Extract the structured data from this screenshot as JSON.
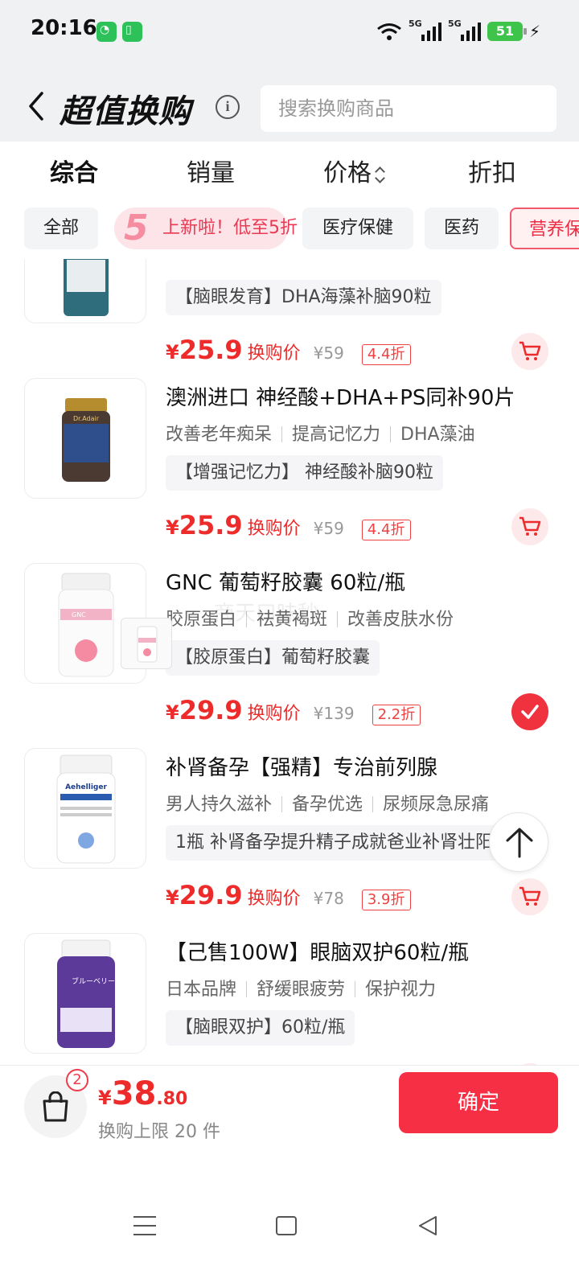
{
  "status_bar": {
    "time": "20:16",
    "net1": "5G",
    "net2": "5G",
    "battery": "51"
  },
  "header": {
    "title": "超值换购",
    "info": "i",
    "search_placeholder": "搜索换购商品"
  },
  "sort_tabs": [
    {
      "label": "综合",
      "active": true
    },
    {
      "label": "销量",
      "active": false
    },
    {
      "label": "价格",
      "active": false,
      "sortable": true
    },
    {
      "label": "折扣",
      "active": false
    }
  ],
  "chips": [
    {
      "label": "全部"
    },
    {
      "label": "上新啦！低至5折",
      "badge": "5"
    },
    {
      "label": "医疗保健"
    },
    {
      "label": "医药"
    },
    {
      "label": "营养保",
      "selected": true
    }
  ],
  "products": [
    {
      "promo": "【脑眼发育】DHA海藻补脑90粒",
      "price_yen": "¥",
      "price": "25.9",
      "price_label": "换购价",
      "orig_price": "¥59",
      "discount": "4.4折",
      "in_cart": false
    },
    {
      "title": "澳洲进口 神经酸+DHA+PS同补90片",
      "tags": [
        "改善老年痴呆",
        "提高记忆力",
        "DHA藻油"
      ],
      "promo": "【增强记忆力】 神经酸补脑90粒",
      "price_yen": "¥",
      "price": "25.9",
      "price_label": "换购价",
      "orig_price": "¥59",
      "discount": "4.4折",
      "in_cart": false,
      "brand": "Dr.Adair"
    },
    {
      "title": "GNC 葡萄籽胶囊 60粒/瓶",
      "tags": [
        "胶原蛋白",
        "祛黄褐斑",
        "改善皮肤水份"
      ],
      "promo": "【胶原蛋白】葡萄籽胶囊",
      "price_yen": "¥",
      "price": "29.9",
      "price_label": "换购价",
      "orig_price": "¥139",
      "discount": "2.2折",
      "in_cart": true,
      "brand": "GNC"
    },
    {
      "title": "补肾备孕【强精】专治前列腺",
      "tags": [
        "男人持久滋补",
        "备孕优选",
        "尿频尿急尿痛"
      ],
      "promo": "1瓶 补肾备孕提升精子成就爸业补肾壮阳强",
      "price_yen": "¥",
      "price": "29.9",
      "price_label": "换购价",
      "orig_price": "¥78",
      "discount": "3.9折",
      "in_cart": false,
      "brand": "Aehelliger"
    },
    {
      "title": "【己售100W】眼脑双护60粒/瓶",
      "tags": [
        "日本品牌",
        "舒缓眼疲劳",
        "保护视力"
      ],
      "promo": "【脑眼双护】60粒/瓶",
      "price": "",
      "in_cart": false,
      "brand": "ブルーベリー"
    }
  ],
  "watermark": "商天口味秒",
  "footer": {
    "cart_count": "2",
    "total_yen": "¥",
    "total_int": "38",
    "total_dec": ".80",
    "limit": "换购上限 20 件",
    "confirm": "确定"
  },
  "colors": {
    "accent": "#ee2b2b",
    "confirm": "#f72f45",
    "header_bg": "#f0f1f3"
  }
}
